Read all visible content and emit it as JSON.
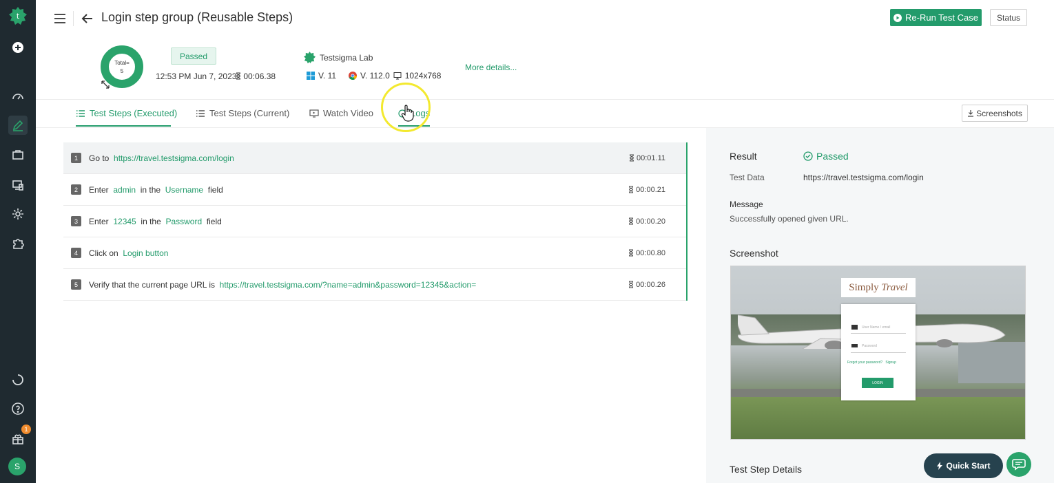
{
  "header": {
    "title": "Login step group (Reusable Steps)",
    "rerun_label": "Re-Run Test Case",
    "status_label": "Status"
  },
  "summary": {
    "total_label": "Total=",
    "total_value": "5",
    "result_badge": "Passed",
    "date": "12:53 PM Jun 7, 2023",
    "duration": "00:06.38",
    "lab": "Testsigma Lab",
    "os_version": "V. 11",
    "browser_version": "V. 112.0",
    "resolution": "1024x768",
    "more_details": "More details..."
  },
  "tabs": [
    {
      "label": "Test Steps (Executed)"
    },
    {
      "label": "Test Steps (Current)"
    },
    {
      "label": "Watch Video"
    },
    {
      "label": "Logs"
    }
  ],
  "screenshots_label": "Screenshots",
  "steps": [
    {
      "num": "1",
      "parts": [
        "Go to",
        "https://travel.testsigma.com/login"
      ],
      "time": "00:01.11"
    },
    {
      "num": "2",
      "parts": [
        "Enter",
        "admin",
        "in the",
        "Username",
        "field"
      ],
      "time": "00:00.21"
    },
    {
      "num": "3",
      "parts": [
        "Enter",
        "12345",
        "in the",
        "Password",
        "field"
      ],
      "time": "00:00.20"
    },
    {
      "num": "4",
      "parts": [
        "Click on",
        "Login button"
      ],
      "time": "00:00.80"
    },
    {
      "num": "5",
      "parts": [
        "Verify that the current page URL is",
        "https://travel.testsigma.com/?name=admin&password=12345&action="
      ],
      "time": "00:00.26"
    }
  ],
  "result_panel": {
    "result_label": "Result",
    "result_value": "Passed",
    "test_data_label": "Test Data",
    "test_data_value": "https://travel.testsigma.com/login",
    "message_label": "Message",
    "message_value": "Successfully opened given URL.",
    "screenshot_label": "Screenshot",
    "details_label": "Test Step Details"
  },
  "screenshot_content": {
    "logo_text_1": "Simply",
    "logo_text_2": "Travel",
    "username_placeholder": "User Name / email",
    "password_placeholder": "Password",
    "forgot_link": "Forgot your password?",
    "signup_link": "Signup",
    "login_button": "LOGIN"
  },
  "sidebar": {
    "avatar_letter": "S",
    "notification_count": "1"
  },
  "quick_start_label": "Quick Start",
  "colors": {
    "accent": "#239b6b",
    "sidebar_bg": "#1f2a30",
    "quick_start_bg": "#26424e"
  }
}
